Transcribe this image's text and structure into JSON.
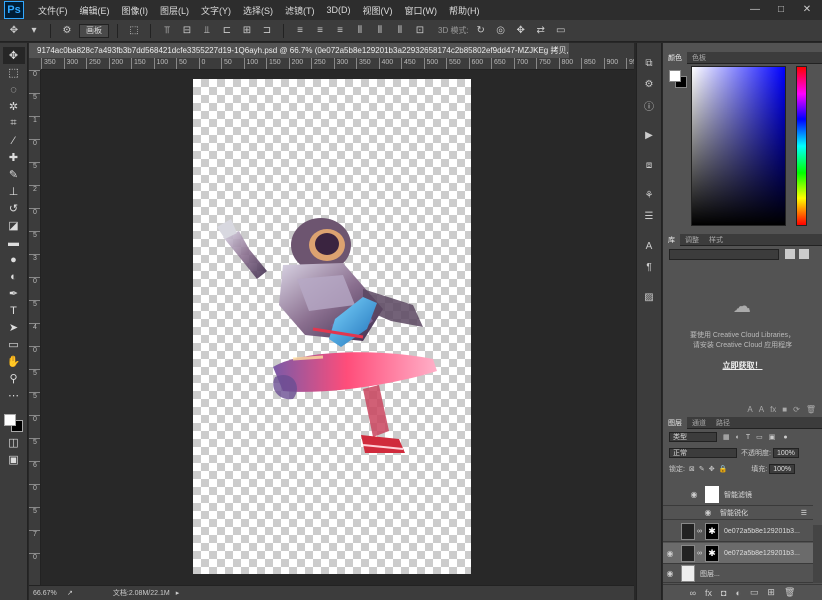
{
  "app": {
    "logo": "Ps"
  },
  "menu": [
    "文件(F)",
    "编辑(E)",
    "图像(I)",
    "图层(L)",
    "文字(Y)",
    "选择(S)",
    "滤镜(T)",
    "3D(D)",
    "视图(V)",
    "窗口(W)",
    "帮助(H)"
  ],
  "window_controls": {
    "minimize": "—",
    "maximize": "□",
    "close": "✕"
  },
  "options_bar": {
    "align_label": "画板",
    "mode3d_label": "3D 模式:"
  },
  "document": {
    "tab_title": "9174ac0ba828c7a493fb3b7dd568421dcfe3355227d19-1Q6ayh.psd @ 66.7% (0e072a5b8e129201b3a22932658174c2b85802ef9dd47-MZJKEg 拷贝, RGB/8) *",
    "close": "×"
  },
  "rulers": {
    "horizontal": [
      "350",
      "300",
      "250",
      "200",
      "150",
      "100",
      "50",
      "0",
      "50",
      "100",
      "150",
      "200",
      "250",
      "300",
      "350",
      "400",
      "450",
      "500",
      "550",
      "600",
      "650",
      "700",
      "750",
      "800",
      "850",
      "900",
      "950"
    ],
    "vertical": [
      "0",
      "5",
      "1",
      "0",
      "5",
      "2",
      "0",
      "5",
      "3",
      "0",
      "5",
      "4",
      "0",
      "5",
      "5",
      "0",
      "5",
      "6",
      "0",
      "5",
      "7",
      "0"
    ]
  },
  "status": {
    "zoom": "66.67%",
    "doc": "文档:2.08M/22.1M"
  },
  "panels": {
    "color_tabs": [
      "颜色",
      "色板"
    ],
    "library_tabs": [
      "库",
      "调整",
      "样式"
    ],
    "library_message_1": "要使用 Creative Cloud Libraries，",
    "library_message_2": "请安装 Creative Cloud 应用程序",
    "library_link": "立即获取！",
    "layers_tabs": [
      "图层",
      "通道",
      "路径"
    ],
    "filter_kind": "类型",
    "blend_mode": "正常",
    "opacity_label": "不透明度:",
    "opacity_value": "100%",
    "lock_label": "锁定:",
    "fill_label": "填充:",
    "fill_value": "100%"
  },
  "layers": [
    {
      "name": "智能滤镜",
      "type": "filter-group"
    },
    {
      "name": "智能锐化",
      "type": "filter"
    },
    {
      "name": "0e072a5b8e129201b3...",
      "visible": false,
      "selected": false
    },
    {
      "name": "0e072a5b8e129201b3...",
      "visible": true,
      "selected": true
    },
    {
      "name": "图层...",
      "visible": true,
      "selected": false
    }
  ],
  "colors": {
    "accent": "#31a8ff",
    "panel": "#535353",
    "dark": "#3c3c3c"
  }
}
